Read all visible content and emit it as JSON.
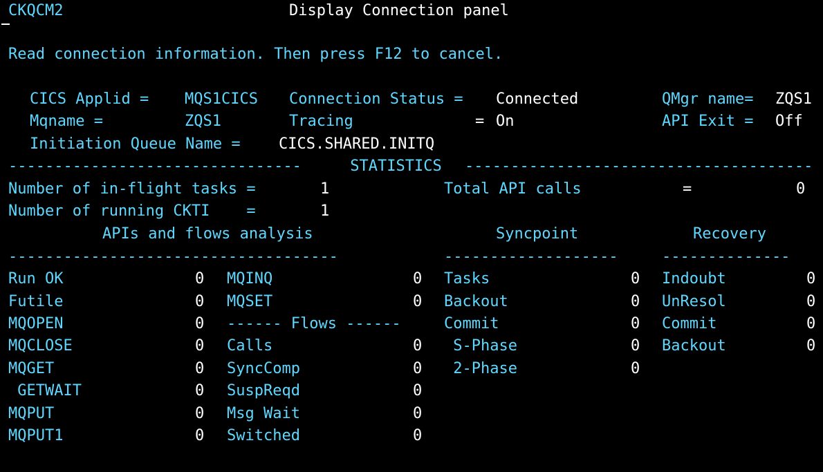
{
  "header": {
    "transaction": "CKQCM2",
    "title": "Display Connection panel"
  },
  "instruction": "Read connection information. Then press F12 to cancel.",
  "connection": {
    "applid_label": "CICS Applid =",
    "applid_value": "MQS1CICS",
    "status_label": "Connection Status =",
    "status_value": "Connected",
    "qmgr_label": "QMgr name=",
    "qmgr_value": "ZQS1",
    "mqname_label": "Mqname =",
    "mqname_value": "ZQS1",
    "tracing_label": "Tracing",
    "tracing_eq": "=",
    "tracing_value": "On",
    "apiexit_label": "API Exit =",
    "apiexit_value": "Off",
    "initq_label": "Initiation Queue Name =",
    "initq_value": "CICS.SHARED.INITQ"
  },
  "statistics": {
    "banner_left": "--------------------------------",
    "banner_label": " STATISTICS ",
    "banner_right": "--------------------------------------",
    "inflight_label": "Number of in-flight tasks =",
    "inflight_value": "1",
    "running_label": "Number of running CKTI    =",
    "running_value": "1",
    "total_api_label": "Total API calls",
    "total_api_eq": "=",
    "total_api_value": "0"
  },
  "sections": {
    "apis_heading": "APIs and flows analysis",
    "syncpoint_heading": "Syncpoint",
    "recovery_heading": "Recovery",
    "apis_dashes": "------------------------------------",
    "syncpoint_dashes": "-------------------",
    "recovery_dashes": "--------------",
    "flows_label": "------ Flows ------"
  },
  "apis": [
    {
      "label": "Run OK",
      "value": "0"
    },
    {
      "label": "Futile",
      "value": "0"
    },
    {
      "label": "MQOPEN",
      "value": "0"
    },
    {
      "label": "MQCLOSE",
      "value": "0"
    },
    {
      "label": "MQGET",
      "value": "0"
    },
    {
      "label": " GETWAIT",
      "value": "0"
    },
    {
      "label": "MQPUT",
      "value": "0"
    },
    {
      "label": "MQPUT1",
      "value": "0"
    }
  ],
  "api2": [
    {
      "label": "MQINQ",
      "value": "0"
    },
    {
      "label": "MQSET",
      "value": "0"
    }
  ],
  "flows": [
    {
      "label": "Calls",
      "value": "0"
    },
    {
      "label": "SyncComp",
      "value": "0"
    },
    {
      "label": "SuspReqd",
      "value": "0"
    },
    {
      "label": "Msg Wait",
      "value": "0"
    },
    {
      "label": "Switched",
      "value": "0"
    }
  ],
  "syncpoint": [
    {
      "label": "Tasks",
      "value": "0"
    },
    {
      "label": "Backout",
      "value": "0"
    },
    {
      "label": "Commit",
      "value": "0"
    },
    {
      "label": " S-Phase",
      "value": "0"
    },
    {
      "label": " 2-Phase",
      "value": "0"
    }
  ],
  "recovery": [
    {
      "label": "Indoubt",
      "value": "0"
    },
    {
      "label": "UnResol",
      "value": "0"
    },
    {
      "label": "Commit",
      "value": "0"
    },
    {
      "label": "Backout",
      "value": "0"
    }
  ]
}
